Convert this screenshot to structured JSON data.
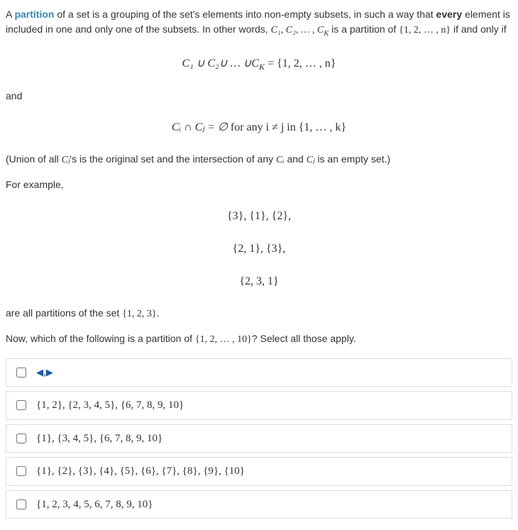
{
  "intro": {
    "prefix": "A ",
    "partition_word": "partition",
    "text1": " of a set is a grouping of the set's elements into non-empty subsets, in such a way that ",
    "every": "every",
    "text2": " element is included in one and only one of the subsets. In other words, ",
    "seq1": "C₁, C₂, … , C",
    "seq1_sub": "K",
    "text3": " is a partition of ",
    "set1": "{1, 2, … , n}",
    "text4": " if and only if"
  },
  "eq1": "C₁ ∪ C₂∪ … ∪C",
  "eq1_sub": "K",
  "eq1_rhs": " = {1, 2, … , n}",
  "and": "and",
  "eq2_lhs": "Cᵢ ∩ Cⱼ = ∅",
  "eq2_rhs": "   for any i ≠ j in {1, … , k}",
  "note": {
    "t1": "(Union of all ",
    "cj": "Cⱼ",
    "t2": "'s is the original set and the intersection of any ",
    "ci": "Cᵢ",
    "t3": " and ",
    "cj2": "Cⱼ",
    "t4": " is an empty set.)"
  },
  "for_example": "For example,",
  "ex1": "{3}, {1}, {2},",
  "ex2": "{2, 1}, {3},",
  "ex3": "{2, 3, 1}",
  "after_examples": {
    "t1": "are all partitions of the set ",
    "set": "{1, 2, 3}",
    "t2": "."
  },
  "question": {
    "t1": "Now, which of the following is a partition of ",
    "set": "{1, 2, … , 10}",
    "t2": "? Select all those apply."
  },
  "options": [
    "",
    "{1, 2}, {2, 3, 4, 5}, {6, 7, 8, 9, 10}",
    "{1}, {3, 4, 5}, {6, 7, 8, 9, 10}",
    "{1}, {2}, {3}, {4}, {5}, {6}, {7}, {8}, {9}, {10}",
    "{1, 2, 3, 4, 5, 6, 7, 8, 9, 10}"
  ]
}
